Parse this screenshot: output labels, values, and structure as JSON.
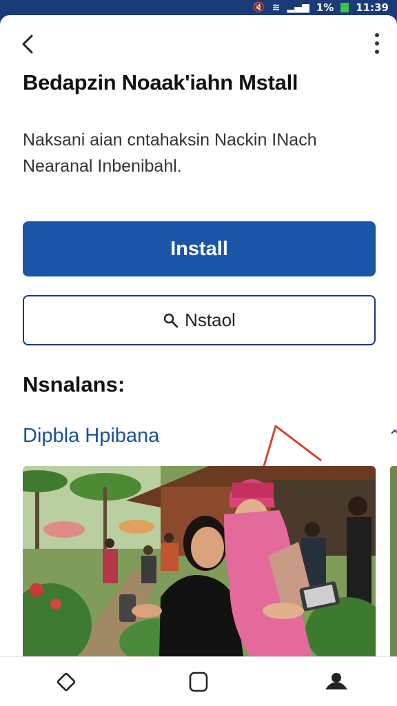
{
  "status_bar": {
    "battery_level": "1%",
    "time": "11:39",
    "icons": [
      "mute-icon",
      "wifi-icon",
      "signal-icon",
      "battery-icon"
    ]
  },
  "app": {
    "title": "Bedapzin Noaak'iahn Mstall",
    "description": "Naksani aian cntahaksin Nackin INach Nearanal Inbenibahl."
  },
  "actions": {
    "install_label": "Install",
    "secondary_label": "Nstaol"
  },
  "section": {
    "heading": "Nsnalans:",
    "link_label": "Dipbla Hpibana"
  },
  "colors": {
    "brand": "#1a3a78",
    "install_button": "#1a55a8",
    "link": "#1a4f9c",
    "battery": "#3bc44b"
  },
  "nav": {
    "icons": [
      "back-icon",
      "home-icon",
      "profile-icon"
    ]
  }
}
